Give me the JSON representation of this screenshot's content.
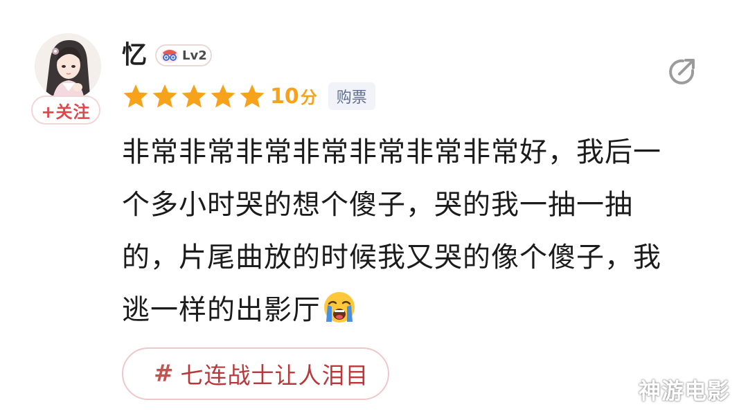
{
  "user": {
    "name": "忆",
    "level": "Lv2",
    "follow_label": "+关注"
  },
  "rating": {
    "stars": 5,
    "max_stars": 5,
    "score_value": "10",
    "score_unit": "分",
    "ticket_tag": "购票"
  },
  "review": {
    "lines": [
      "非常非常非常非常非常非常非常好，我后一",
      "个多小时哭的想个傻子，哭的我一抽一抽",
      "的，片尾曲放的时候我又哭的像个傻子，我",
      "逃一样的出影厅"
    ],
    "trailing_emoji": "crying-face"
  },
  "topic": {
    "hash": "#",
    "text": "七连战士让人泪目"
  },
  "watermark": "神游电影",
  "icons": {
    "share": "share-icon",
    "level": "level-badge-icon",
    "star": "star-icon"
  },
  "colors": {
    "accent_red": "#e0474c",
    "star_yellow": "#f7a21b",
    "tag_bg": "#f1f3f8",
    "tag_text": "#5f6e92",
    "topic_text": "#b6383a"
  }
}
